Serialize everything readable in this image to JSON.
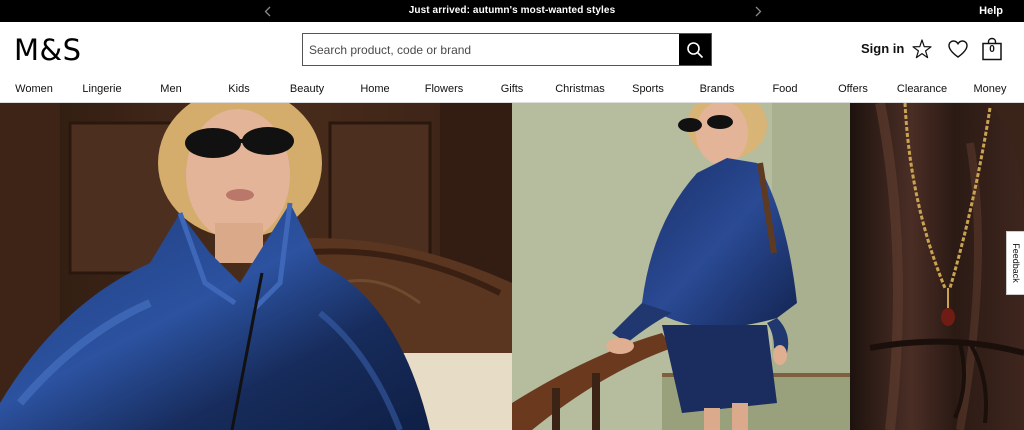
{
  "promo": {
    "text": "Just arrived: autumn's most-wanted styles",
    "prev_icon": "chevron-left-icon",
    "next_icon": "chevron-right-icon",
    "help_label": "Help"
  },
  "header": {
    "logo": "M&S",
    "search_placeholder": "Search product, code or brand",
    "search_value": "",
    "sign_in_label": "Sign in",
    "bag_count": "0",
    "icons": [
      "search-icon",
      "sparkle-icon",
      "heart-icon",
      "bag-icon"
    ]
  },
  "nav": {
    "items": [
      {
        "label": "Women"
      },
      {
        "label": "Lingerie"
      },
      {
        "label": "Men"
      },
      {
        "label": "Kids"
      },
      {
        "label": "Beauty"
      },
      {
        "label": "Home"
      },
      {
        "label": "Flowers"
      },
      {
        "label": "Gifts"
      },
      {
        "label": "Christmas"
      },
      {
        "label": "Sports"
      },
      {
        "label": "Brands"
      },
      {
        "label": "Food"
      },
      {
        "label": "Offers"
      },
      {
        "label": "Clearance"
      },
      {
        "label": "Money"
      }
    ]
  },
  "feedback_label": "Feedback",
  "colors": {
    "promo_bg": "#000000",
    "text": "#111111",
    "search_btn_bg": "#000000"
  }
}
